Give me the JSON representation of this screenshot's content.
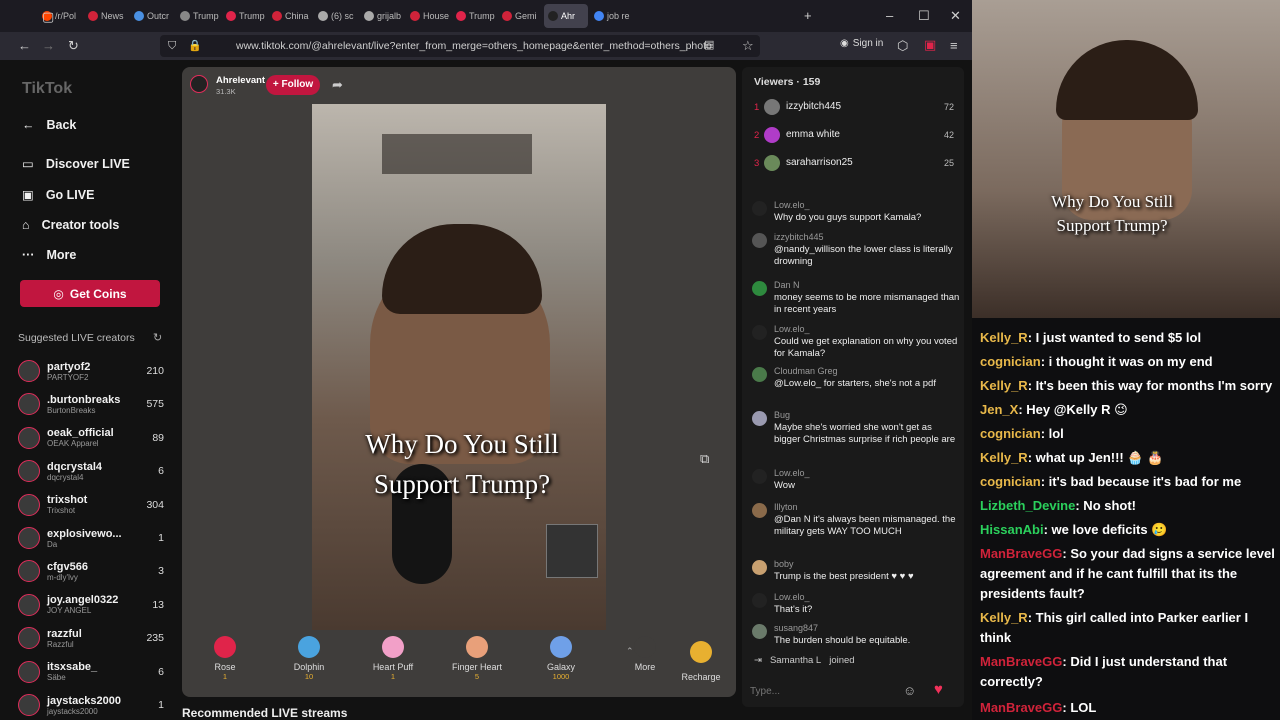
{
  "browser": {
    "tabs": [
      "/r/Pol",
      "News",
      "Outcr",
      "Trump",
      "Trump",
      "China",
      "(6) sc",
      "grijalb",
      "House",
      "Trump",
      "Gemi",
      "Ahr",
      "job re"
    ],
    "url": "www.tiktok.com/@ahrelevant/live?enter_from_merge=others_homepage&enter_method=others_photo",
    "sign_in": "Sign in"
  },
  "sidebar": {
    "logo": "TikTok",
    "back": "Back",
    "nav": [
      "Discover LIVE",
      "Go LIVE",
      "Creator tools",
      "More"
    ],
    "get_coins": "Get Coins",
    "suggested_title": "Suggested LIVE creators",
    "creators": [
      {
        "name": "partyof2",
        "sub": "PARTYOF2",
        "count": "210"
      },
      {
        "name": ".burtonbreaks",
        "sub": "BurtonBreaks",
        "count": "575"
      },
      {
        "name": "oeak_official",
        "sub": "OEAK Apparel",
        "count": "89"
      },
      {
        "name": "dqcrystal4",
        "sub": "dqcrystal4",
        "count": "6"
      },
      {
        "name": "trixshot",
        "sub": "Trixshot",
        "count": "304"
      },
      {
        "name": "explosivewo...",
        "sub": "Da",
        "count": "1"
      },
      {
        "name": "cfgv566",
        "sub": "m-dly'lvy",
        "count": "3"
      },
      {
        "name": "joy.angel0322",
        "sub": "JOY ANGEL",
        "count": "13"
      },
      {
        "name": "razzful",
        "sub": "Razzful",
        "count": "235"
      },
      {
        "name": "itsxsabe_",
        "sub": "Säbe",
        "count": "6"
      },
      {
        "name": "jaystacks2000",
        "sub": "jaystacks2000",
        "count": "1"
      }
    ]
  },
  "stream": {
    "host": "Ahrelevant",
    "host_likes": "31.3K",
    "follow": "+ Follow",
    "caption": [
      "Why Do You Still",
      "Support Trump?"
    ],
    "recommended": "Recommended LIVE streams",
    "gifts": [
      {
        "name": "Rose",
        "price": "1",
        "color": "#e0244a"
      },
      {
        "name": "Dolphin",
        "price": "10",
        "color": "#4aa3df"
      },
      {
        "name": "Heart Puff",
        "price": "1",
        "color": "#f2a0c8"
      },
      {
        "name": "Finger Heart",
        "price": "5",
        "color": "#e8a07a"
      },
      {
        "name": "Galaxy",
        "price": "1000",
        "color": "#6fa0e8"
      },
      {
        "name": "More",
        "price": "",
        "color": "#3f3d3b"
      }
    ],
    "recharge": "Recharge"
  },
  "viewers": {
    "title": "Viewers · 159",
    "top": [
      {
        "rank": "1",
        "name": "izzybitch445",
        "score": "72"
      },
      {
        "rank": "2",
        "name": "emma white",
        "score": "42"
      },
      {
        "rank": "3",
        "name": "saraharrison25",
        "score": "25"
      }
    ]
  },
  "chat": [
    {
      "user": "Low.elo_",
      "text": "Why do you guys support Kamala?"
    },
    {
      "user": "izzybitch445",
      "text": "@nandy_willison the lower class is literally drowning"
    },
    {
      "user": "Dan N",
      "text": "money seems to be more mismanaged than in recent years"
    },
    {
      "user": "Low.elo_",
      "text": "Could we get explanation on why you voted for Kamala?"
    },
    {
      "user": "Cloudman Greg",
      "text": "@Low.elo_ for starters, she's not a pdf"
    },
    {
      "user": "Bug",
      "text": "Maybe she's worried she won't get as bigger Christmas surprise if rich people are"
    },
    {
      "user": "Low.elo_",
      "text": "Wow"
    },
    {
      "user": "Illyton",
      "text": "@Dan N it's always been mismanaged. the military gets WAY TOO MUCH"
    },
    {
      "user": "boby",
      "text": "Trump is the best president ♥ ♥ ♥"
    },
    {
      "user": "Low.elo_",
      "text": "That's it?"
    },
    {
      "user": "susang847",
      "text": "The burden should be equitable."
    }
  ],
  "joined": {
    "user": "Samantha L",
    "text": "joined"
  },
  "chat_input_placeholder": "Type...",
  "webcam_caption": [
    "Why Do You Still",
    "Support Trump?"
  ],
  "twitch": [
    {
      "user": "Kelly_R",
      "color": "#e8b84a",
      "text": ": I just wanted to send $5 lol"
    },
    {
      "user": "cognician",
      "color": "#e8b84a",
      "text": ": i thought it was on my end"
    },
    {
      "user": "Kelly_R",
      "color": "#e8b84a",
      "text": ": It's been this way for months I'm sorry"
    },
    {
      "user": "Jen_X",
      "color": "#e8b84a",
      "text": ": Hey @Kelly R 😉"
    },
    {
      "user": "cognician",
      "color": "#e8b84a",
      "text": ": lol"
    },
    {
      "user": "Kelly_R",
      "color": "#e8b84a",
      "text": ": what up Jen!!! 🧁 🎂"
    },
    {
      "user": "cognician",
      "color": "#e8b84a",
      "text": ": it's bad because it's bad for me"
    },
    {
      "user": "Lizbeth_Devine",
      "color": "#2bd05c",
      "text": ": No shot!"
    },
    {
      "user": "HissanAbi",
      "color": "#2bd05c",
      "text": ": we love deficits 🥲"
    },
    {
      "user": "ManBraveGG",
      "color": "#d0233a",
      "text": ": So your dad signs a service level agreement and if he cant fulfill that its the presidents fault?"
    },
    {
      "user": "Kelly_R",
      "color": "#e8b84a",
      "text": ": This girl called into Parker earlier I think"
    },
    {
      "user": "ManBraveGG",
      "color": "#d0233a",
      "text": ": Did I just understand that correctly?"
    },
    {
      "user": "ManBraveGG",
      "color": "#d0233a",
      "text": ": LOL"
    }
  ]
}
